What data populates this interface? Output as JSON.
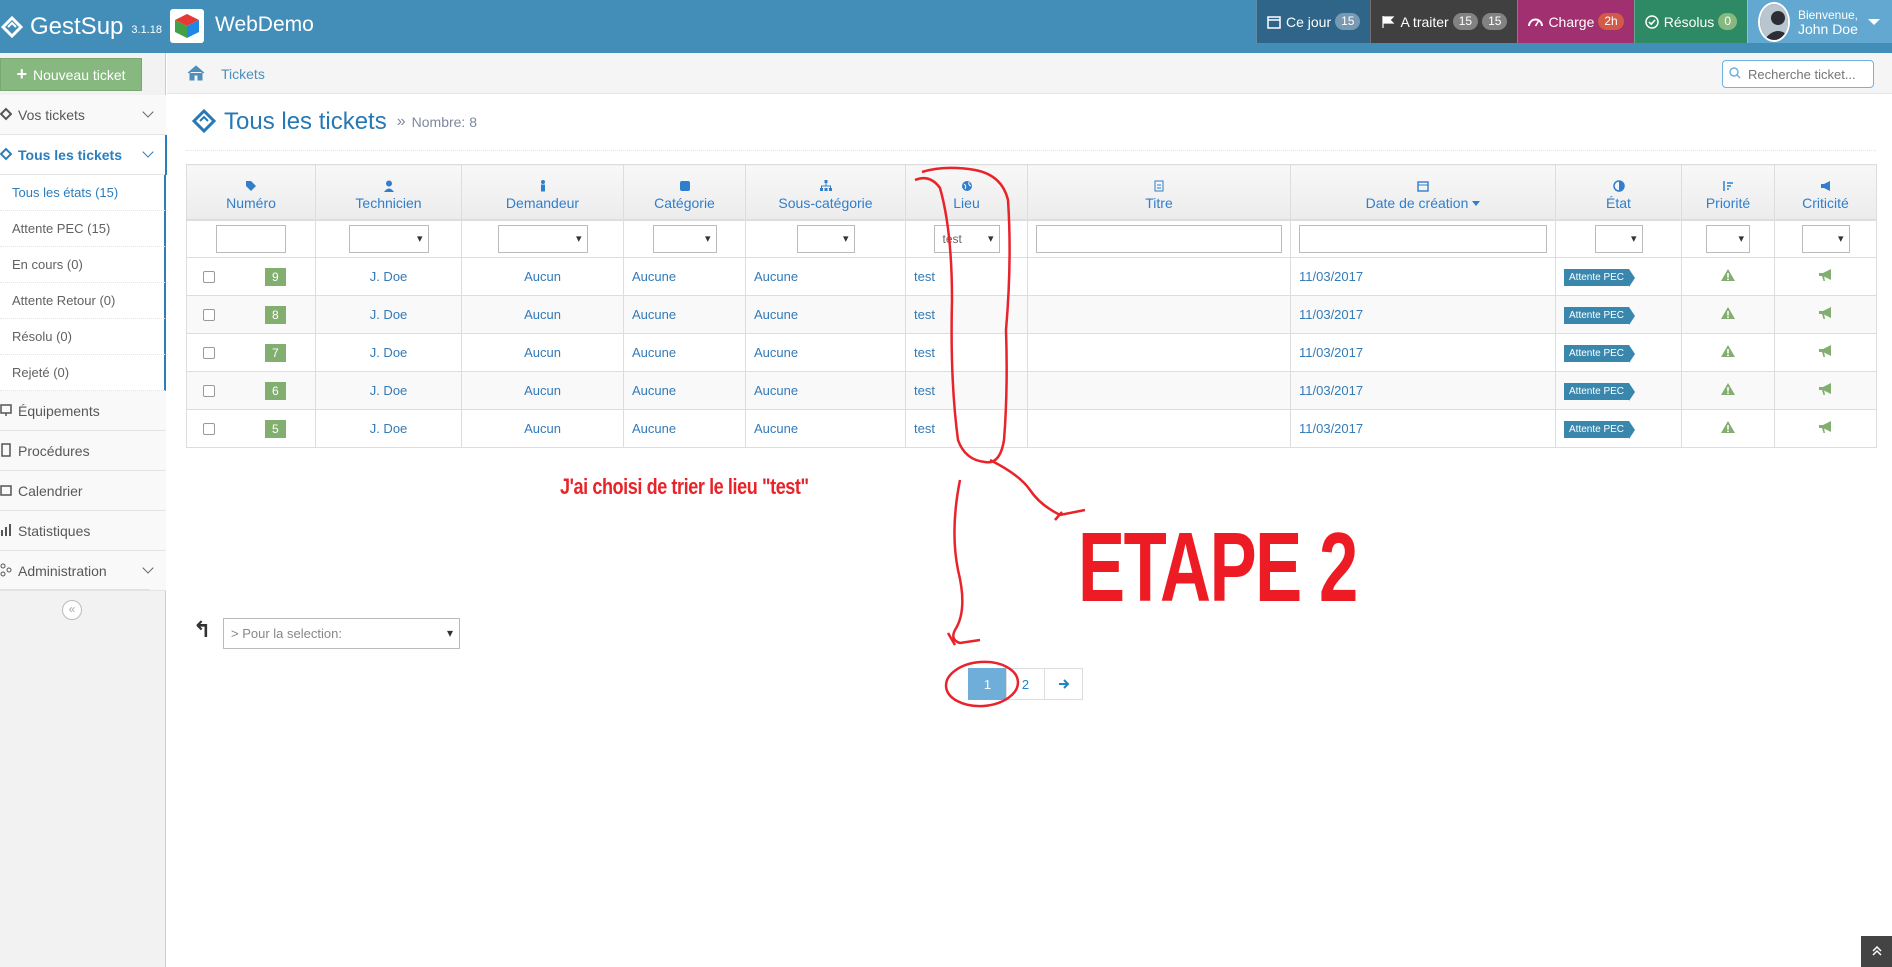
{
  "app": {
    "name": "GestSup",
    "version": "3.1.18",
    "company": "WebDemo"
  },
  "navbar": {
    "today": {
      "label": "Ce jour",
      "count": "15"
    },
    "to_treat": {
      "label": "A traiter",
      "count1": "15",
      "count2": "15"
    },
    "charge": {
      "label": "Charge",
      "value": "2h"
    },
    "solved": {
      "label": "Résolus",
      "count": "0"
    },
    "user": {
      "greeting": "Bienvenue,",
      "name": "John Doe"
    }
  },
  "sidebar": {
    "new_ticket": "Nouveau ticket",
    "your_tickets": "Vos tickets",
    "all_tickets": "Tous les tickets",
    "states": [
      {
        "label": "Tous les états (15)"
      },
      {
        "label": "Attente PEC (15)"
      },
      {
        "label": "En cours (0)"
      },
      {
        "label": "Attente Retour (0)"
      },
      {
        "label": "Résolu (0)"
      },
      {
        "label": "Rejeté (0)"
      }
    ],
    "equipment": "Équipements",
    "procedures": "Procédures",
    "calendar": "Calendrier",
    "statistics": "Statistiques",
    "administration": "Administration",
    "collapse": "«"
  },
  "breadcrumb": {
    "label": "Tickets"
  },
  "search": {
    "placeholder": "Recherche ticket..."
  },
  "page": {
    "title": "Tous les tickets",
    "separator": "»",
    "count": "Nombre: 8"
  },
  "table": {
    "headers": [
      "Numéro",
      "Technicien",
      "Demandeur",
      "Catégorie",
      "Sous-catégorie",
      "Lieu",
      "Titre",
      "Date de création",
      "État",
      "Priorité",
      "Criticité"
    ],
    "filter_lieu": "test",
    "rows": [
      {
        "num": "9",
        "technician": "J. Doe",
        "requester": "Aucun",
        "category": "Aucune",
        "subcategory": "Aucune",
        "place": "test",
        "title": "",
        "date": "11/03/2017",
        "state": "Attente PEC"
      },
      {
        "num": "8",
        "technician": "J. Doe",
        "requester": "Aucun",
        "category": "Aucune",
        "subcategory": "Aucune",
        "place": "test",
        "title": "",
        "date": "11/03/2017",
        "state": "Attente PEC"
      },
      {
        "num": "7",
        "technician": "J. Doe",
        "requester": "Aucun",
        "category": "Aucune",
        "subcategory": "Aucune",
        "place": "test",
        "title": "",
        "date": "11/03/2017",
        "state": "Attente PEC"
      },
      {
        "num": "6",
        "technician": "J. Doe",
        "requester": "Aucun",
        "category": "Aucune",
        "subcategory": "Aucune",
        "place": "test",
        "title": "",
        "date": "11/03/2017",
        "state": "Attente PEC"
      },
      {
        "num": "5",
        "technician": "J. Doe",
        "requester": "Aucun",
        "category": "Aucune",
        "subcategory": "Aucune",
        "place": "test",
        "title": "",
        "date": "11/03/2017",
        "state": "Attente PEC"
      }
    ]
  },
  "bulk": {
    "arrow": "↰",
    "placeholder": "> Pour la selection:"
  },
  "pagination": {
    "pages": [
      "1",
      "2"
    ],
    "next": "→"
  },
  "annotations": {
    "note": "J'ai choisi de trier  le lieu \"test\"",
    "step": "ETAPE 2",
    "color": "#ed1c24"
  },
  "colors": {
    "navbar": "#438eb9",
    "accent": "#2679b5",
    "badge_green": "#82af6f",
    "state_blue": "#3a87ad"
  }
}
